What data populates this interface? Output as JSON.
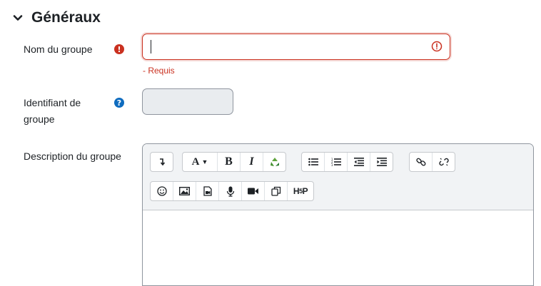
{
  "section": {
    "title": "Généraux",
    "chevron_icon": "chevron-down-icon"
  },
  "fields": {
    "group_name": {
      "label": "Nom du groupe",
      "value": "",
      "required_text": "- Requis",
      "badge_icon": "required-icon"
    },
    "group_id": {
      "label_line1": "Identifiant de",
      "label_line2": "groupe",
      "value": "",
      "badge_icon": "help-icon"
    },
    "description": {
      "label": "Description du groupe",
      "value": ""
    }
  },
  "editor_toolbar": {
    "row1": [
      {
        "name": "toggle-toolbar-icon",
        "glyph": "⤵"
      },
      {
        "name": "font-size-icon",
        "glyph": "A ▾"
      },
      {
        "name": "bold-icon",
        "glyph": "B"
      },
      {
        "name": "italic-icon",
        "glyph": "I"
      },
      {
        "name": "recycle-icon",
        "glyph": "♻"
      },
      {
        "name": "bullet-list-icon",
        "glyph": "≡"
      },
      {
        "name": "numbered-list-icon",
        "glyph": "⋮≡"
      },
      {
        "name": "outdent-icon",
        "glyph": "⇤"
      },
      {
        "name": "indent-icon",
        "glyph": "⇥"
      },
      {
        "name": "link-icon",
        "glyph": "🔗"
      },
      {
        "name": "unlink-icon",
        "glyph": "⛓"
      }
    ],
    "row2": [
      {
        "name": "emoji-icon",
        "glyph": "☺"
      },
      {
        "name": "image-icon",
        "glyph": "▣"
      },
      {
        "name": "media-icon",
        "glyph": "▤"
      },
      {
        "name": "microphone-icon",
        "glyph": "🎙"
      },
      {
        "name": "video-icon",
        "glyph": "■"
      },
      {
        "name": "copy-icon",
        "glyph": "⧉"
      },
      {
        "name": "h5p-icon",
        "glyph": "H5P"
      }
    ]
  },
  "colors": {
    "error": "#ca3120",
    "help": "#0f6cbf",
    "text": "#1d2125"
  }
}
